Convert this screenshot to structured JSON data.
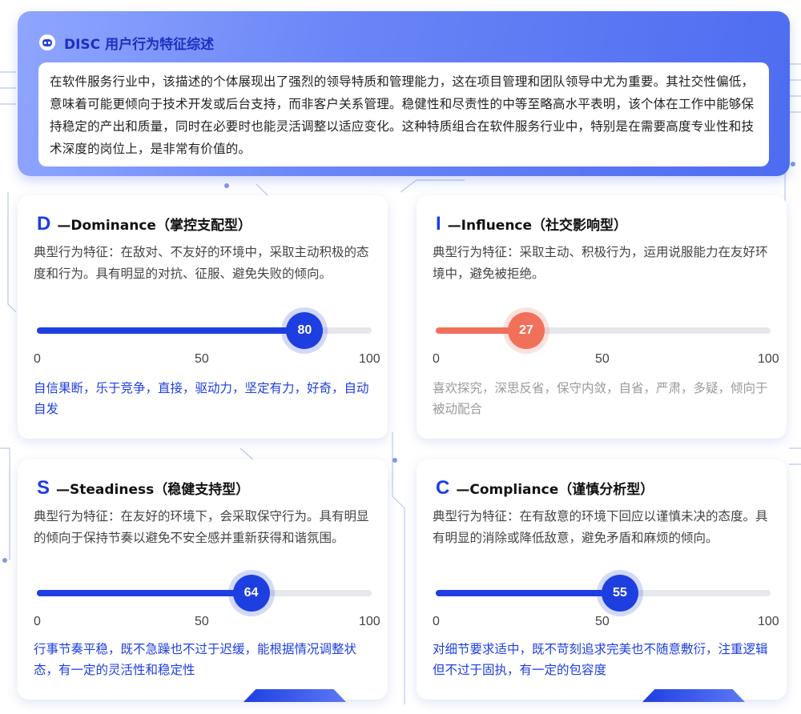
{
  "header": {
    "icon": "bot-icon",
    "title": "DISC 用户行为特征综述",
    "body": "在软件服务行业中，该描述的个体展现出了强烈的领导特质和管理能力，这在项目管理和团队领导中尤为重要。其社交性偏低，意味着可能更倾向于技术开发或后台支持，而非客户关系管理。稳健性和尽责性的中等至略高水平表明，该个体在工作中能够保持稳定的产出和质量，同时在必要时也能灵活调整以适应变化。这种特质组合在软件服务行业中，特别是在需要高度专业性和技术深度的岗位上，是非常有价值的。"
  },
  "cards": {
    "d": {
      "letter": "D",
      "title": "—Dominance（掌控支配型）",
      "desc": "典型行为特征：在敌对、不友好的环境中，采取主动积极的态度和行为。具有明显的对抗、征服、避免失败的倾向。",
      "score": 80,
      "score_label": "80",
      "ticks": [
        "0",
        "50",
        "100"
      ],
      "traits": "自信果断，乐于竞争，直接，驱动力，坚定有力，好奇，自动自发",
      "color": "#1e3fe0",
      "traits_color": "#1e3fe0"
    },
    "i": {
      "letter": "I",
      "title": "—Influence（社交影响型）",
      "desc": "典型行为特征：采取主动、积极行为，运用说服能力在友好环境中，避免被拒绝。",
      "score": 27,
      "score_label": "27",
      "ticks": [
        "0",
        "50",
        "100"
      ],
      "traits": "喜欢探究，深思反省，保守内敛，自省，严肃，多疑，倾向于被动配合",
      "color": "#f0705a",
      "traits_color": "#9a9a9a"
    },
    "s": {
      "letter": "S",
      "title": "—Steadiness（稳健支持型）",
      "desc": "典型行为特征：在友好的环境下，会采取保守行为。具有明显的倾向于保持节奏以避免不安全感并重新获得和谐氛围。",
      "score": 64,
      "score_label": "64",
      "ticks": [
        "0",
        "50",
        "100"
      ],
      "traits": "行事节奏平稳，既不急躁也不过于迟缓，能根据情况调整状态，有一定的灵活性和稳定性",
      "color": "#1e3fe0",
      "traits_color": "#1e3fe0"
    },
    "c": {
      "letter": "C",
      "title": "—Compliance（谨慎分析型）",
      "desc": "典型行为特征：在有敌意的环境下回应以谨慎未决的态度。具有明显的消除或降低敌意，避免矛盾和麻烦的倾向。",
      "score": 55,
      "score_label": "55",
      "ticks": [
        "0",
        "50",
        "100"
      ],
      "traits": "对细节要求适中，既不苛刻追求完美也不随意敷衍，注重逻辑但不过于固执，有一定的包容度",
      "color": "#1e3fe0",
      "traits_color": "#1e3fe0"
    }
  }
}
